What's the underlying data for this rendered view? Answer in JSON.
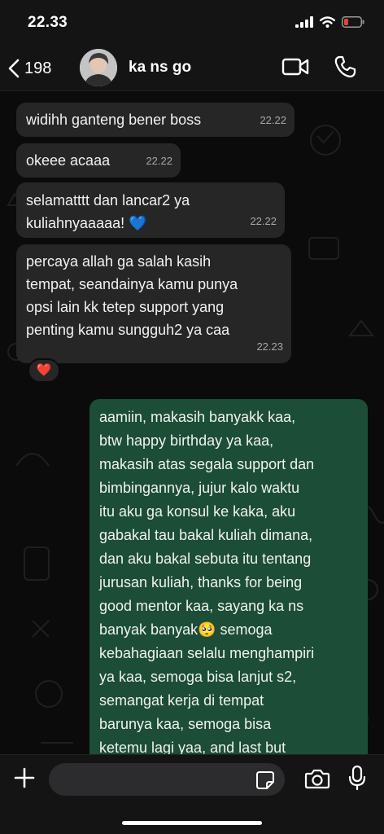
{
  "status_bar": {
    "time": "22.33"
  },
  "header": {
    "back_count": "198",
    "contact_name": "ka ns go"
  },
  "messages": [
    {
      "direction": "incoming",
      "text": "widihh ganteng bener boss",
      "time": "22.22"
    },
    {
      "direction": "incoming",
      "text": "okeee acaaa",
      "time": "22.22"
    },
    {
      "direction": "incoming",
      "text": "selamatttt dan lancar2 ya\nkuliahnyaaaaa! 💙",
      "time": "22.22"
    },
    {
      "direction": "incoming",
      "text": "percaya allah ga salah kasih\ntempat, seandainya kamu punya\nopsi lain kk tetep support yang\npenting kamu sungguh2 ya caa",
      "time": "22.23",
      "reaction": "❤️"
    },
    {
      "direction": "outgoing",
      "text": "aamiin, makasih banyakk kaa,\nbtw happy birthday ya kaa,\nmakasih atas segala support dan\nbimbingannya, jujur kalo waktu\nitu aku ga konsul ke kaka, aku\ngabakal tau bakal kuliah dimana,\ndan aku bakal sebuta itu tentang\njurusan kuliah, thanks for being\ngood mentor kaa, sayang ka ns\nbanyak banyak🥺 semoga\nkebahagiaan selalu menghampiri\nya kaa, semoga bisa lanjut s2,\nsemangat kerja di tempat\nbarunya kaa, semoga bisa\nketemu lagi yaa, and last but\nleast bahagia selalu bersama"
    }
  ],
  "input": {
    "placeholder": "",
    "value": ""
  },
  "icons": {
    "back": "chevron-left-icon",
    "video": "video-camera-icon",
    "call": "phone-icon",
    "plus": "plus-icon",
    "sticker": "sticker-icon",
    "camera": "camera-icon",
    "mic": "microphone-icon"
  },
  "colors": {
    "incoming_bubble": "#262626",
    "outgoing_bubble": "#1c4d36",
    "background": "#0b0b0b",
    "bars": "#141414"
  }
}
